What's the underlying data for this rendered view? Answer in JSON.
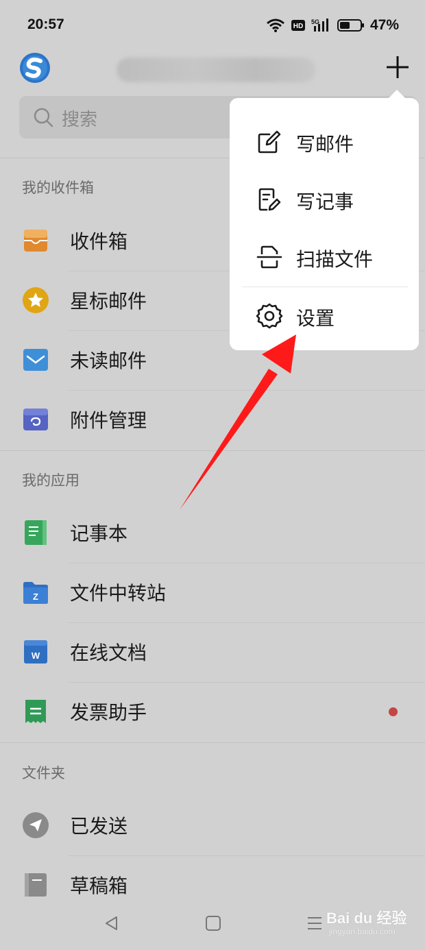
{
  "status_bar": {
    "time": "20:57",
    "battery": "47%",
    "icons": [
      "wifi-icon",
      "hd-icon",
      "5g-signal-icon",
      "battery-icon"
    ]
  },
  "header": {
    "account_name": "",
    "icons": [
      "app-logo",
      "plus-icon"
    ]
  },
  "search": {
    "placeholder": "搜索"
  },
  "sections": {
    "mailbox": {
      "title": "我的收件箱",
      "items": [
        {
          "label": "收件箱",
          "icon": "inbox-icon",
          "color": "#e0892f"
        },
        {
          "label": "星标邮件",
          "icon": "star-icon",
          "color": "#e0a514"
        },
        {
          "label": "未读邮件",
          "icon": "mail-icon",
          "color": "#3f8fd8"
        },
        {
          "label": "附件管理",
          "icon": "attachment-icon",
          "color": "#5563c4"
        }
      ]
    },
    "apps": {
      "title": "我的应用",
      "items": [
        {
          "label": "记事本",
          "icon": "notebook-icon",
          "color": "#36a65c"
        },
        {
          "label": "文件中转站",
          "icon": "folder-z-icon",
          "color": "#2f6fc2"
        },
        {
          "label": "在线文档",
          "icon": "word-doc-icon",
          "color": "#2f6fc2"
        },
        {
          "label": "发票助手",
          "icon": "invoice-icon",
          "color": "#2f9a56",
          "has_badge": true
        }
      ]
    },
    "folders": {
      "title": "文件夹",
      "items": [
        {
          "label": "已发送",
          "icon": "sent-icon",
          "color": "#8a8a8a"
        },
        {
          "label": "草稿箱",
          "icon": "draft-icon",
          "color": "#8a8a8a"
        }
      ]
    }
  },
  "popup_menu": {
    "items": [
      {
        "label": "写邮件",
        "icon": "compose-icon"
      },
      {
        "label": "写记事",
        "icon": "note-edit-icon"
      },
      {
        "label": "扫描文件",
        "icon": "scan-icon"
      },
      {
        "label": "设置",
        "icon": "gear-icon"
      }
    ]
  },
  "annotation": {
    "color": "#ff1a1a"
  },
  "watermark": {
    "brand": "Bai du 经验",
    "sub": "jingyan.baidu.com"
  },
  "nav_bar": {
    "icons": [
      "back-icon",
      "home-icon",
      "menu-icon"
    ]
  }
}
